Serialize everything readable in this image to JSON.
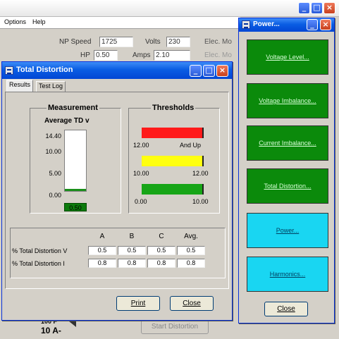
{
  "main_window": {
    "menu": [
      "Options",
      "Help"
    ],
    "fields": {
      "np_speed_label": "NP Speed",
      "np_speed_value": "1725",
      "volts_label": "Volts",
      "volts_value": "230",
      "elec_label": "Elec. Mo",
      "hp_label": "HP",
      "hp_value": "0.50",
      "amps_label": "Amps",
      "amps_value": "2.10",
      "elec2_label": "Elec. Mo"
    },
    "footer": {
      "partial_text_top": "100 F",
      "partial_text": "10 A-",
      "start_button": "Start Distortion"
    }
  },
  "td_dialog": {
    "title": "Total Distortion",
    "tabs": [
      "Results",
      "Test Log"
    ],
    "measurement": {
      "group_title": "Measurement",
      "subtitle": "Average TD v",
      "ticks": [
        "14.40",
        "10.00",
        "5.00",
        "0.00"
      ],
      "scale_max": 14.4,
      "value": 0.5,
      "readout": "0.50"
    },
    "thresholds": {
      "group_title": "Thresholds",
      "bars": [
        {
          "color": "#ff1a1a",
          "left_label": "12.00",
          "right_label": "And Up"
        },
        {
          "color": "#ffff10",
          "left_label": "10.00",
          "right_label": "12.00"
        },
        {
          "color": "#17a517",
          "left_label": "0.00",
          "right_label": "10.00"
        }
      ]
    },
    "table": {
      "headers": [
        "A",
        "B",
        "C",
        "Avg."
      ],
      "rows": [
        {
          "label": "% Total Distortion V",
          "values": [
            "0.5",
            "0.5",
            "0.5",
            "0.5"
          ]
        },
        {
          "label": "% Total Distortion I",
          "values": [
            "0.8",
            "0.8",
            "0.8",
            "0.8"
          ]
        }
      ]
    },
    "buttons": {
      "print": "Print",
      "close": "Close"
    }
  },
  "power_window": {
    "title": "Power...",
    "buttons": [
      {
        "label": "Voltage Level...",
        "color": "green"
      },
      {
        "label": "Voltage Imbalance...",
        "color": "green"
      },
      {
        "label": "Current Imbalance...",
        "color": "green"
      },
      {
        "label": "Total Distortion...",
        "color": "green"
      },
      {
        "label": "Power...",
        "color": "cyan"
      },
      {
        "label": "Harmonics...",
        "color": "cyan"
      }
    ],
    "close_label": "Close"
  },
  "colors": {
    "titlebar_blue": "#0a5de3",
    "palette_green": "#0b8a0b",
    "palette_cyan": "#19d6f2"
  }
}
